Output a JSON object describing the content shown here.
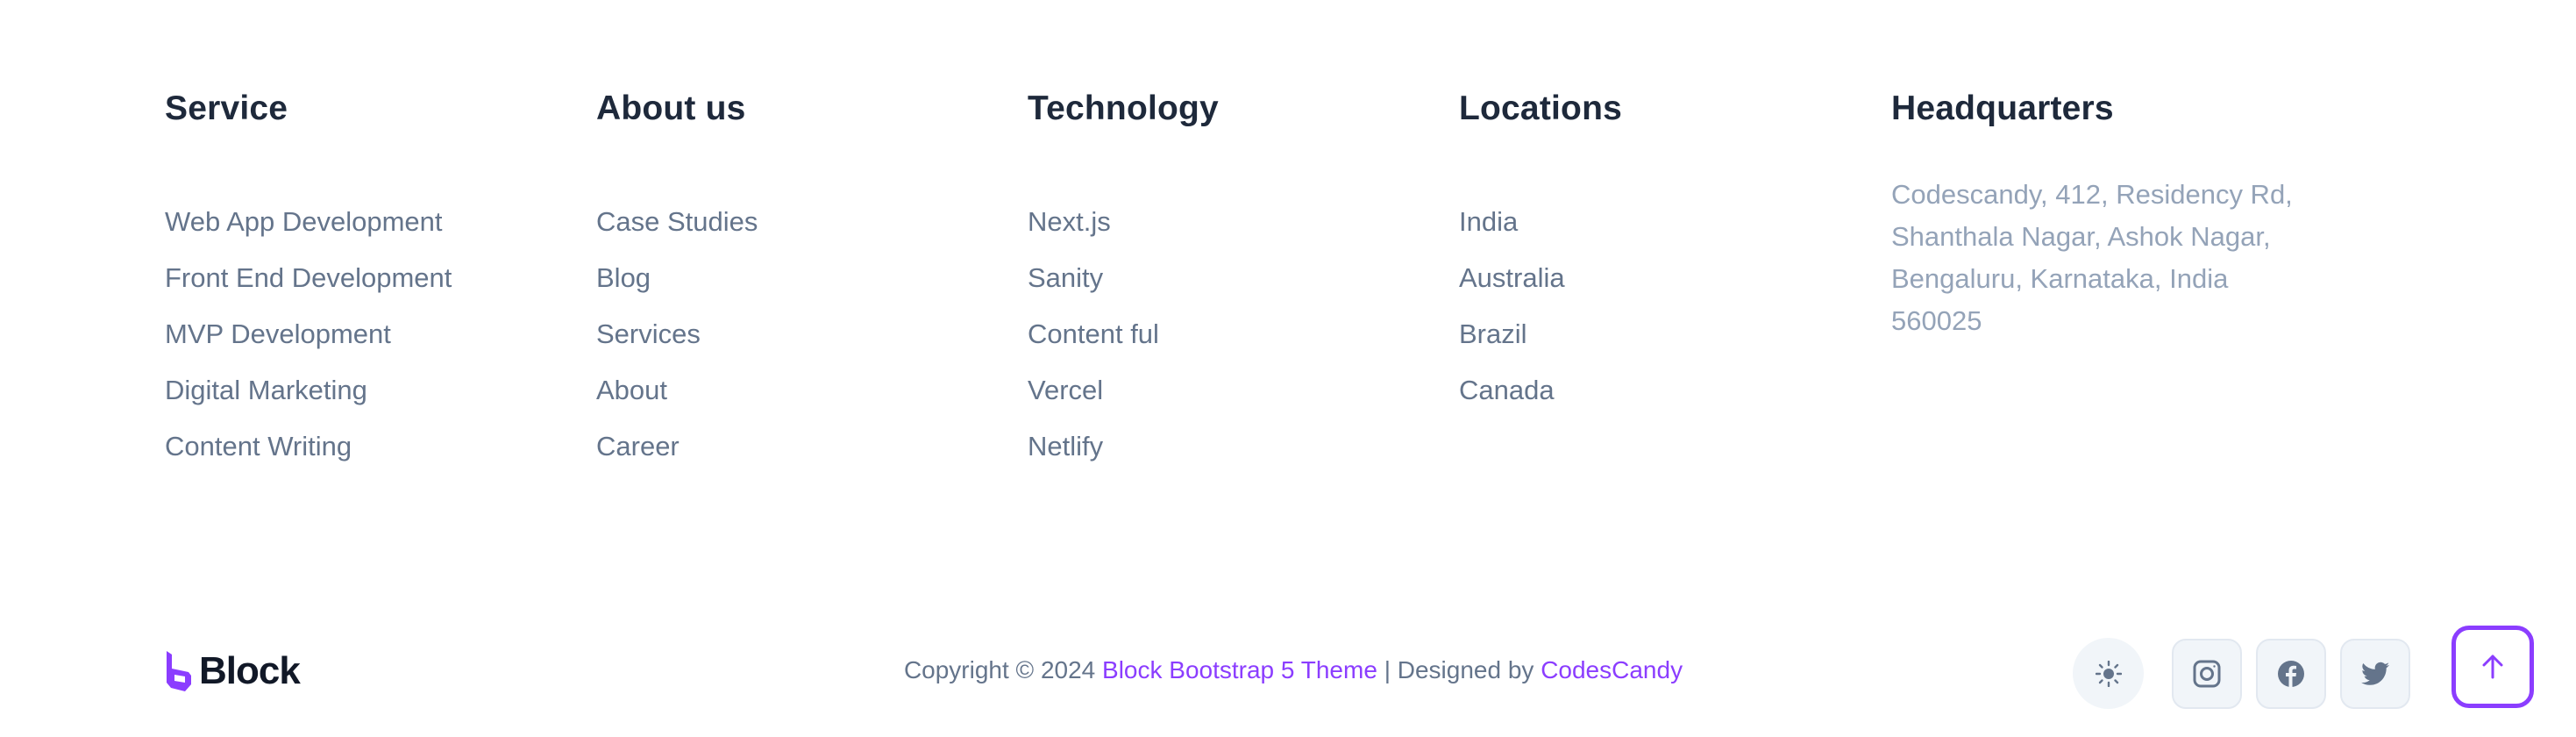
{
  "columns": [
    {
      "title": "Service",
      "items": [
        "Web App Development",
        "Front End Development",
        "MVP Development",
        "Digital Marketing",
        "Content Writing"
      ]
    },
    {
      "title": "About us",
      "items": [
        "Case Studies",
        "Blog",
        "Services",
        "About",
        "Career"
      ]
    },
    {
      "title": "Technology",
      "items": [
        "Next.js",
        "Sanity",
        "Content ful",
        "Vercel",
        "Netlify"
      ]
    },
    {
      "title": "Locations",
      "items": [
        "India",
        "Australia",
        "Brazil",
        "Canada"
      ]
    }
  ],
  "headquarters": {
    "title": "Headquarters",
    "lines": [
      "Codescandy, 412, Residency Rd,",
      "Shanthala Nagar, Ashok Nagar,",
      "Bengaluru, Karnataka, India",
      "560025"
    ]
  },
  "footer": {
    "logo_text": "Block",
    "copyright_prefix": "Copyright © 2024",
    "theme_link": "Block Bootstrap 5 Theme",
    "separator": "| Designed by",
    "author_link": "CodesCandy"
  },
  "icons": {
    "theme_toggle": "sun-icon",
    "socials": [
      "instagram-icon",
      "facebook-icon",
      "twitter-icon"
    ],
    "back_to_top": "arrow-up-icon"
  },
  "colors": {
    "accent": "#8b3dff",
    "heading": "#1e293b",
    "link": "#64748b",
    "muted": "#94a3b8"
  }
}
